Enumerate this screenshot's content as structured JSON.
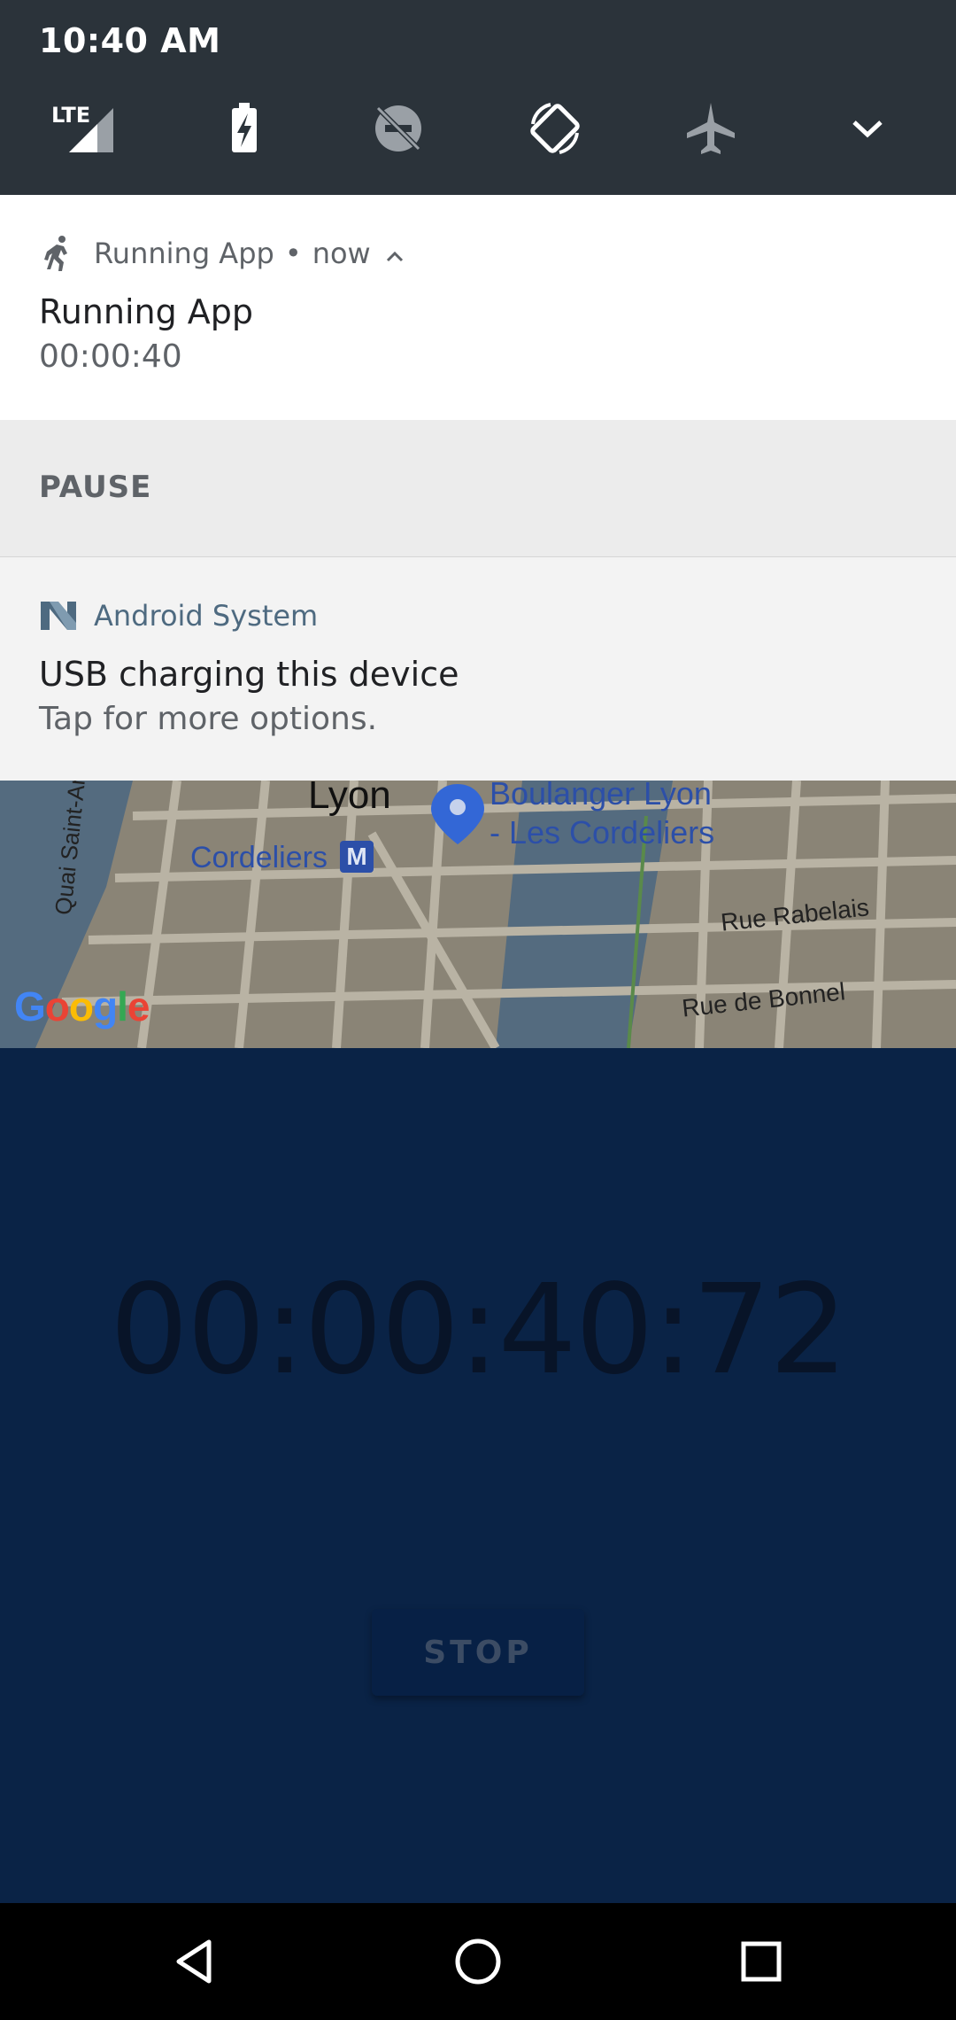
{
  "status_bar": {
    "time": "10:40 AM",
    "network": "LTE"
  },
  "quick_settings": [
    {
      "name": "signal",
      "label": "LTE"
    },
    {
      "name": "battery-charging"
    },
    {
      "name": "do-not-disturb-off"
    },
    {
      "name": "auto-rotate"
    },
    {
      "name": "airplane-mode"
    },
    {
      "name": "expand"
    }
  ],
  "notification_running": {
    "app_name": "Running App",
    "separator": "•",
    "time": "now",
    "title": "Running App",
    "text": "00:00:40",
    "action": "PAUSE"
  },
  "notification_system": {
    "app_name": "Android System",
    "title": "USB charging this device",
    "text": "Tap for more options."
  },
  "map": {
    "labels": {
      "city": "Lyon",
      "poi": "Boulanger Lyon",
      "poi_line2": "- Les Cordeliers",
      "metro": "Cordeliers",
      "metro_badge": "M",
      "street1": "Quai Saint-Antoine",
      "street2": "Rue Rabelais",
      "street3": "Rue de Bonnel"
    },
    "logo": "Google"
  },
  "app": {
    "timer": "00:00:40:72",
    "stop_label": "STOP"
  },
  "colors": {
    "quick_settings_bg": "#2b333a",
    "app_bg": "#0a2346",
    "accent": "#3367d6"
  }
}
